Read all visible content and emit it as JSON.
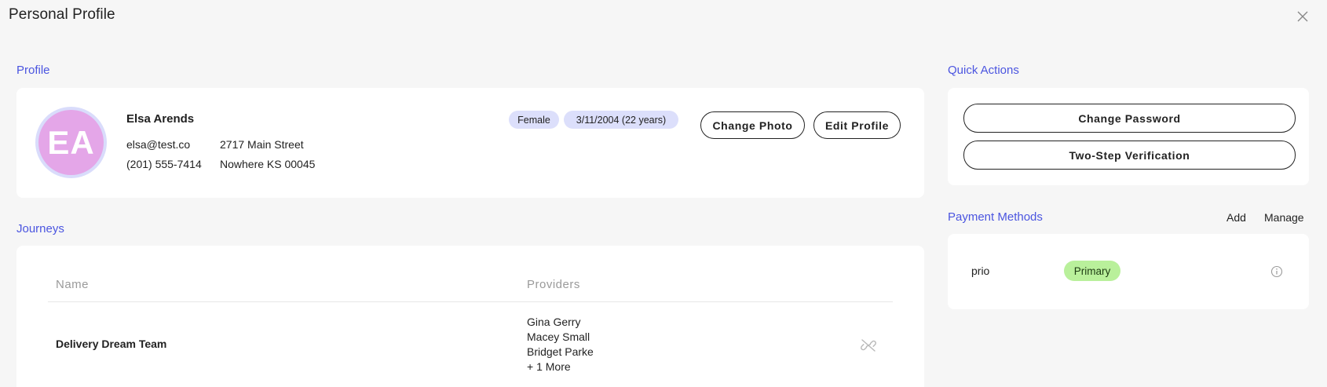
{
  "header": {
    "title": "Personal Profile",
    "close_icon": "close-icon"
  },
  "profile": {
    "section_label": "Profile",
    "avatar_initials": "EA",
    "name": "Elsa Arends",
    "email": "elsa@test.co",
    "phone": "(201) 555-7414",
    "address_line1": "2717 Main Street",
    "address_line2": "Nowhere KS 00045",
    "gender": "Female",
    "dob": "3/11/2004 (22 years)",
    "change_photo_label": "Change Photo",
    "edit_profile_label": "Edit Profile",
    "colors": {
      "avatar_bg": "#e4a6e8",
      "avatar_ring": "#d9dcfb",
      "pill_bg": "#dcdffb"
    }
  },
  "journeys": {
    "section_label": "Journeys",
    "columns": [
      "Name",
      "Providers"
    ],
    "rows": [
      {
        "name": "Delivery Dream Team",
        "providers": [
          "Gina Gerry",
          "Macey Small",
          "Bridget Parke",
          "+ 1 More"
        ],
        "action_icon": "unlink-icon"
      }
    ]
  },
  "quick_actions": {
    "section_label": "Quick Actions",
    "change_password_label": "Change Password",
    "two_step_label": "Two-Step Verification"
  },
  "payment_methods": {
    "section_label": "Payment Methods",
    "add_label": "Add",
    "manage_label": "Manage",
    "items": [
      {
        "name": "prio",
        "badge": "Primary",
        "info_icon": "info-icon"
      }
    ],
    "colors": {
      "primary_badge_bg": "#b9f09b"
    }
  },
  "colors": {
    "accent": "#4b55e0",
    "page_bg": "#f6f6f6",
    "card_bg": "#ffffff"
  }
}
